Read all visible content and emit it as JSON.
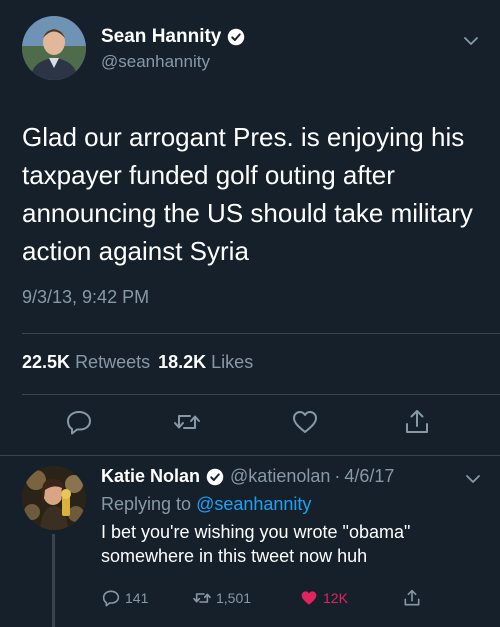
{
  "colors": {
    "background": "#15202b",
    "text": "#ffffff",
    "secondary_text": "#8899a6",
    "link": "#1da1f2",
    "like": "#e0245e",
    "divider": "#38444d"
  },
  "main_tweet": {
    "author_name": "Sean Hannity",
    "author_handle": "@seanhannity",
    "verified": true,
    "text": "Glad our arrogant Pres. is enjoying his taxpayer funded golf outing after announcing the US should take military action against Syria",
    "timestamp": "9/3/13, 9:42 PM",
    "retweets_count": "22.5K",
    "retweets_label": "Retweets",
    "likes_count": "18.2K",
    "likes_label": "Likes",
    "icons": [
      "reply-icon",
      "retweet-icon",
      "like-icon",
      "share-icon"
    ]
  },
  "reply_tweet": {
    "author_name": "Katie Nolan",
    "author_handle": "@katienolan",
    "separator": "·",
    "date": "4/6/17",
    "verified": true,
    "replying_prefix": "Replying to",
    "replying_to": "@seanhannity",
    "text": "I bet you're wishing you wrote \"obama\" somewhere in this tweet now huh",
    "reply_count": "141",
    "retweet_count": "1,501",
    "like_count": "12K",
    "liked": true
  }
}
